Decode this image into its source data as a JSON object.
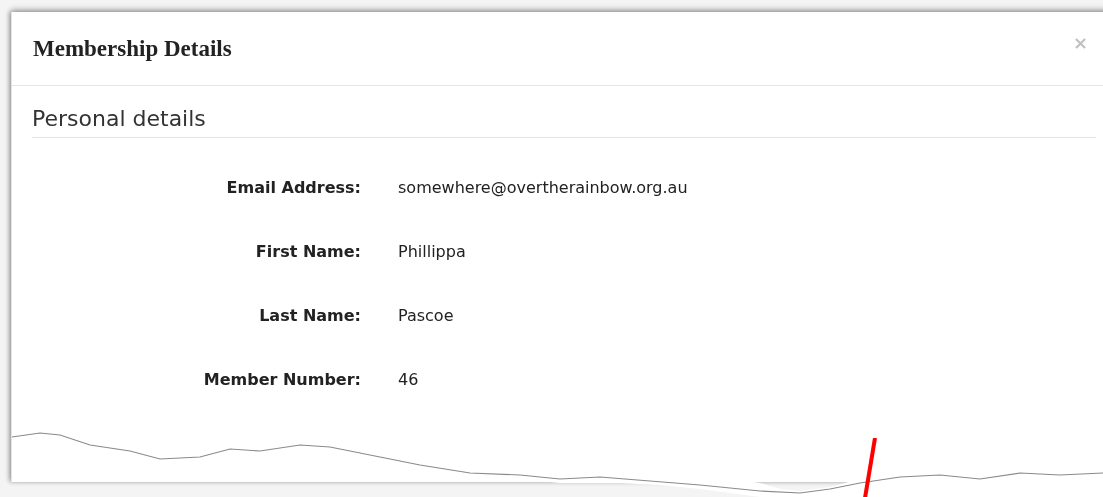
{
  "dialog": {
    "title": "Membership Details",
    "close": "×"
  },
  "section": {
    "heading": "Personal details"
  },
  "fields": [
    {
      "label": "Email Address:",
      "value": "somewhere@overtherainbow.org.au"
    },
    {
      "label": "First Name:",
      "value": "Phillippa"
    },
    {
      "label": "Last Name:",
      "value": "Pascoe"
    },
    {
      "label": "Member Number:",
      "value": "46"
    }
  ]
}
